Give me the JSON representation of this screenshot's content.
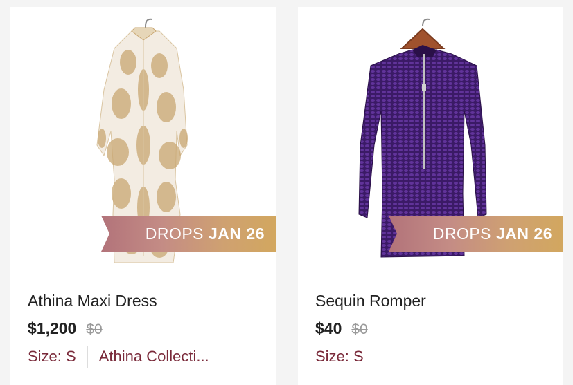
{
  "products": [
    {
      "title": "Athina Maxi Dress",
      "price": "$1,200",
      "original_price": "$0",
      "size": "Size: S",
      "brand": "Athina Collecti...",
      "ribbon_word": "DROPS",
      "ribbon_date": "JAN 26",
      "image_icon": "maxi-dress-image"
    },
    {
      "title": "Sequin Romper",
      "price": "$40",
      "original_price": "$0",
      "size": "Size: S",
      "ribbon_word": "DROPS",
      "ribbon_date": "JAN 26",
      "image_icon": "sequin-romper-image"
    }
  ],
  "colors": {
    "ribbon_start": "#b2737a",
    "ribbon_end": "#d2a75f",
    "meta_text": "#7a2a3a",
    "strike_price": "#9a9a9a",
    "romper": "#3b1a66"
  }
}
